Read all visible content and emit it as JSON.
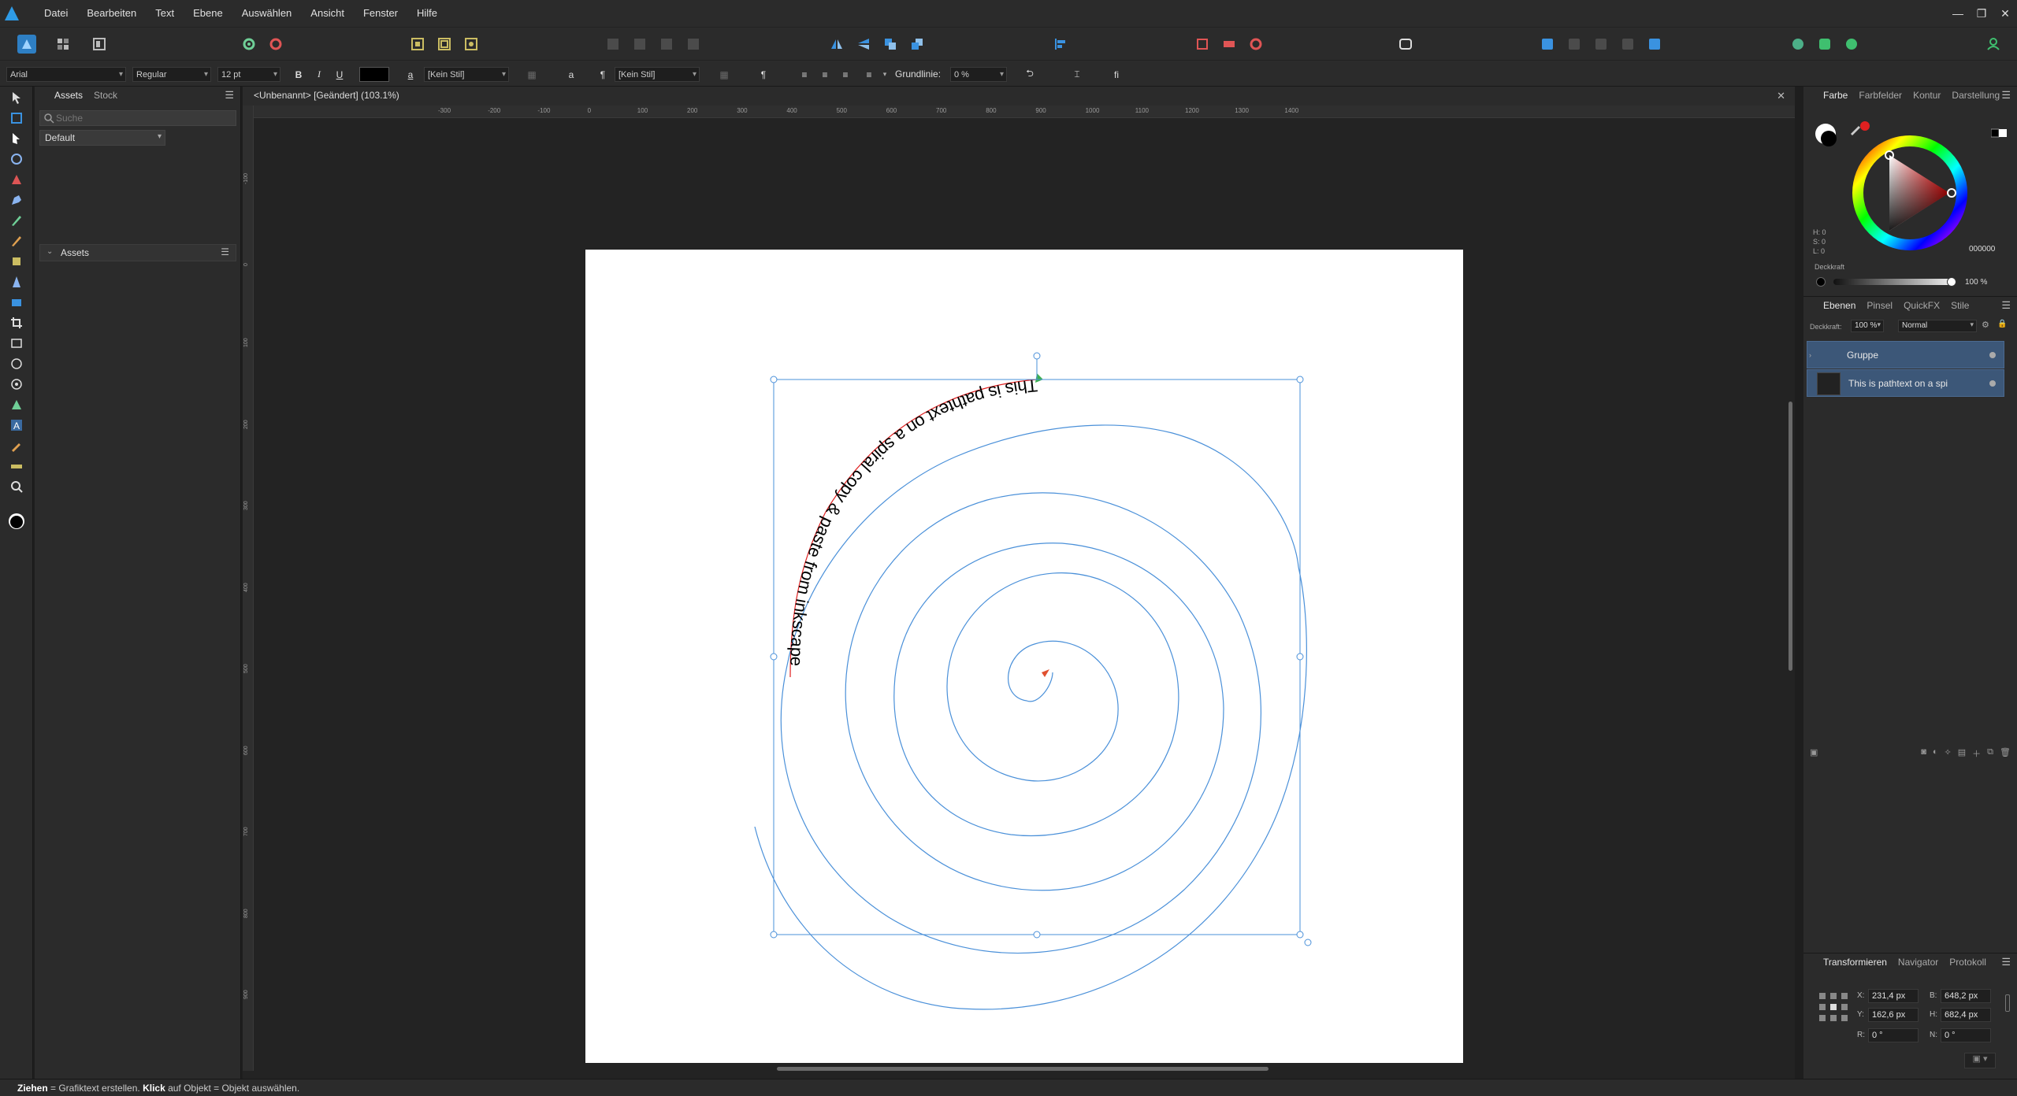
{
  "app": {
    "menus": [
      "Datei",
      "Bearbeiten",
      "Text",
      "Ebene",
      "Auswählen",
      "Ansicht",
      "Fenster",
      "Hilfe"
    ],
    "window_controls": [
      "—",
      "❐",
      "✕"
    ]
  },
  "context_bar": {
    "font_family": "Arial",
    "font_style": "Regular",
    "font_size": "12 pt",
    "bold": "B",
    "italic": "I",
    "underline": "U",
    "char_style_glyph": "a",
    "char_style": "[Kein Stil]",
    "para_style_glyph": "¶",
    "para_style": "[Kein Stil]",
    "small_a": "a",
    "baseline_label": "Grundlinie:",
    "baseline_value": "0 %",
    "fi_label": "fi"
  },
  "assets_panel": {
    "tabs": [
      "Assets",
      "Stock"
    ],
    "search_placeholder": "Suche",
    "category_dropdown": "Default",
    "group_label": "Assets"
  },
  "document": {
    "tab_title": "<Unbenannt> [Geändert] (103.1%)",
    "ruler_top_labels": [
      "-300",
      "-200",
      "-100",
      "0",
      "100",
      "200",
      "300",
      "400",
      "500",
      "600",
      "700",
      "800",
      "900",
      "1000",
      "1100",
      "1200",
      "1300",
      "1400"
    ],
    "ruler_left_labels": [
      "-100",
      "0",
      "100",
      "200",
      "300",
      "400",
      "500",
      "600",
      "700",
      "800",
      "900"
    ],
    "path_text": "This is pathtext on a spiral copy & paste from inkscape"
  },
  "color_panel": {
    "tabs": [
      "Farbe",
      "Farbfelder",
      "Kontur",
      "Darstellung"
    ],
    "h_label": "H: 0",
    "s_label": "S: 0",
    "l_label": "L: 0",
    "hex_value": "000000",
    "opacity_label": "Deckkraft",
    "opacity_value": "100 %",
    "accent_color": "#e02020"
  },
  "layers_panel": {
    "tabs": [
      "Ebenen",
      "Pinsel",
      "QuickFX",
      "Stile"
    ],
    "opacity_label": "Deckkraft:",
    "opacity_value": "100 %",
    "blend_mode": "Normal",
    "layers": [
      {
        "name": "Gruppe"
      },
      {
        "name": "This is pathtext on a spi"
      }
    ]
  },
  "transform_panel": {
    "tabs": [
      "Transformieren",
      "Navigator",
      "Protokoll"
    ],
    "x_label": "X:",
    "x_value": "231,4 px",
    "y_label": "Y:",
    "y_value": "162,6 px",
    "w_label": "B:",
    "w_value": "648,2 px",
    "h_label": "H:",
    "h_value": "682,4 px",
    "r_label": "R:",
    "r_value": "0 °",
    "s_label": "N:",
    "s_value": "0 °"
  },
  "status_bar": {
    "drag_bold": "Ziehen",
    "drag_text": " = Grafiktext erstellen. ",
    "click_bold": "Klick",
    "click_text": " auf Objekt = Objekt auswählen."
  }
}
